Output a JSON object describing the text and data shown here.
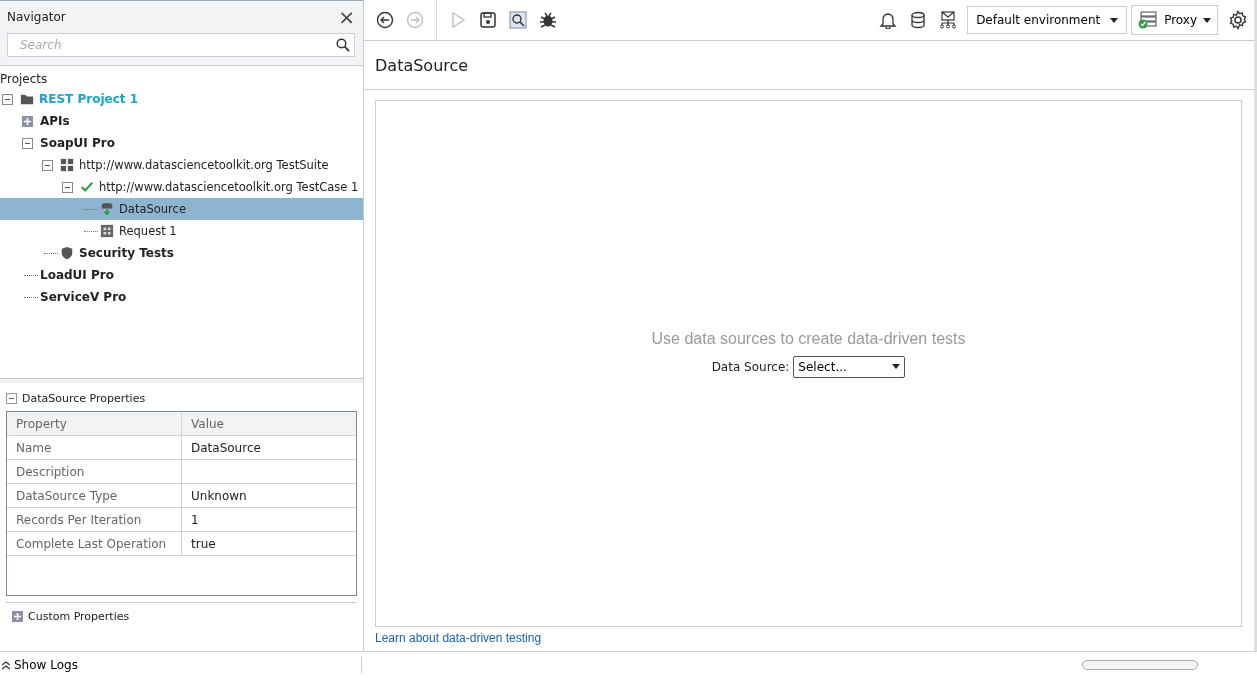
{
  "navigator": {
    "title": "Navigator",
    "close": "×",
    "search": {
      "placeholder": "Search"
    }
  },
  "tree": {
    "heading": "Projects",
    "items": [
      {
        "label": "REST Project 1",
        "kind": "project",
        "expanded": true,
        "selected": false,
        "children": [
          {
            "label": "APIs",
            "kind": "group",
            "expanded": false,
            "selected": false
          },
          {
            "label": "SoapUI Pro",
            "kind": "group",
            "expanded": true,
            "selected": false,
            "children": [
              {
                "label": "http://www.datasciencetoolkit.org TestSuite",
                "kind": "suite",
                "expanded": true,
                "selected": false,
                "children": [
                  {
                    "label": "http://www.datasciencetoolkit.org TestCase 1",
                    "kind": "testcase",
                    "expanded": true,
                    "selected": false,
                    "children": [
                      {
                        "label": "DataSource",
                        "kind": "datasource",
                        "selected": true
                      },
                      {
                        "label": "Request 1",
                        "kind": "request",
                        "selected": false
                      }
                    ]
                  }
                ]
              },
              {
                "label": "Security Tests",
                "kind": "security",
                "selected": false
              }
            ]
          },
          {
            "label": "LoadUI Pro",
            "kind": "group",
            "selected": false
          },
          {
            "label": "ServiceV Pro",
            "kind": "group",
            "selected": false
          }
        ]
      }
    ]
  },
  "properties": {
    "title": "DataSource Properties",
    "expanded": true,
    "columns": [
      "Property",
      "Value"
    ],
    "rows": [
      [
        "Name",
        "DataSource"
      ],
      [
        "Description",
        ""
      ],
      [
        "DataSource Type",
        "Unknown"
      ],
      [
        "Records Per Iteration",
        "1"
      ],
      [
        "Complete Last Operation",
        "true"
      ]
    ]
  },
  "custom_properties": {
    "title": "Custom Properties",
    "expanded": false
  },
  "show_logs": "Show Logs",
  "toolbar": {
    "left": [
      {
        "kind": "back",
        "disabled": false
      },
      {
        "kind": "forward",
        "disabled": true
      },
      {
        "kind": "run",
        "disabled": true
      },
      {
        "kind": "save",
        "disabled": false
      },
      {
        "kind": "inspect",
        "disabled": false
      },
      {
        "kind": "bug",
        "disabled": false
      }
    ],
    "right": [
      {
        "kind": "bell",
        "disabled": false
      },
      {
        "kind": "database",
        "disabled": false
      },
      {
        "kind": "network",
        "disabled": false
      }
    ],
    "environment": "Default environment",
    "proxy": "Proxy"
  },
  "editor": {
    "title": "DataSource",
    "hint": "Use data sources to create data-driven tests",
    "source_label": "Data Source:",
    "source_value": "Select...",
    "link": "Learn about data-driven testing"
  }
}
